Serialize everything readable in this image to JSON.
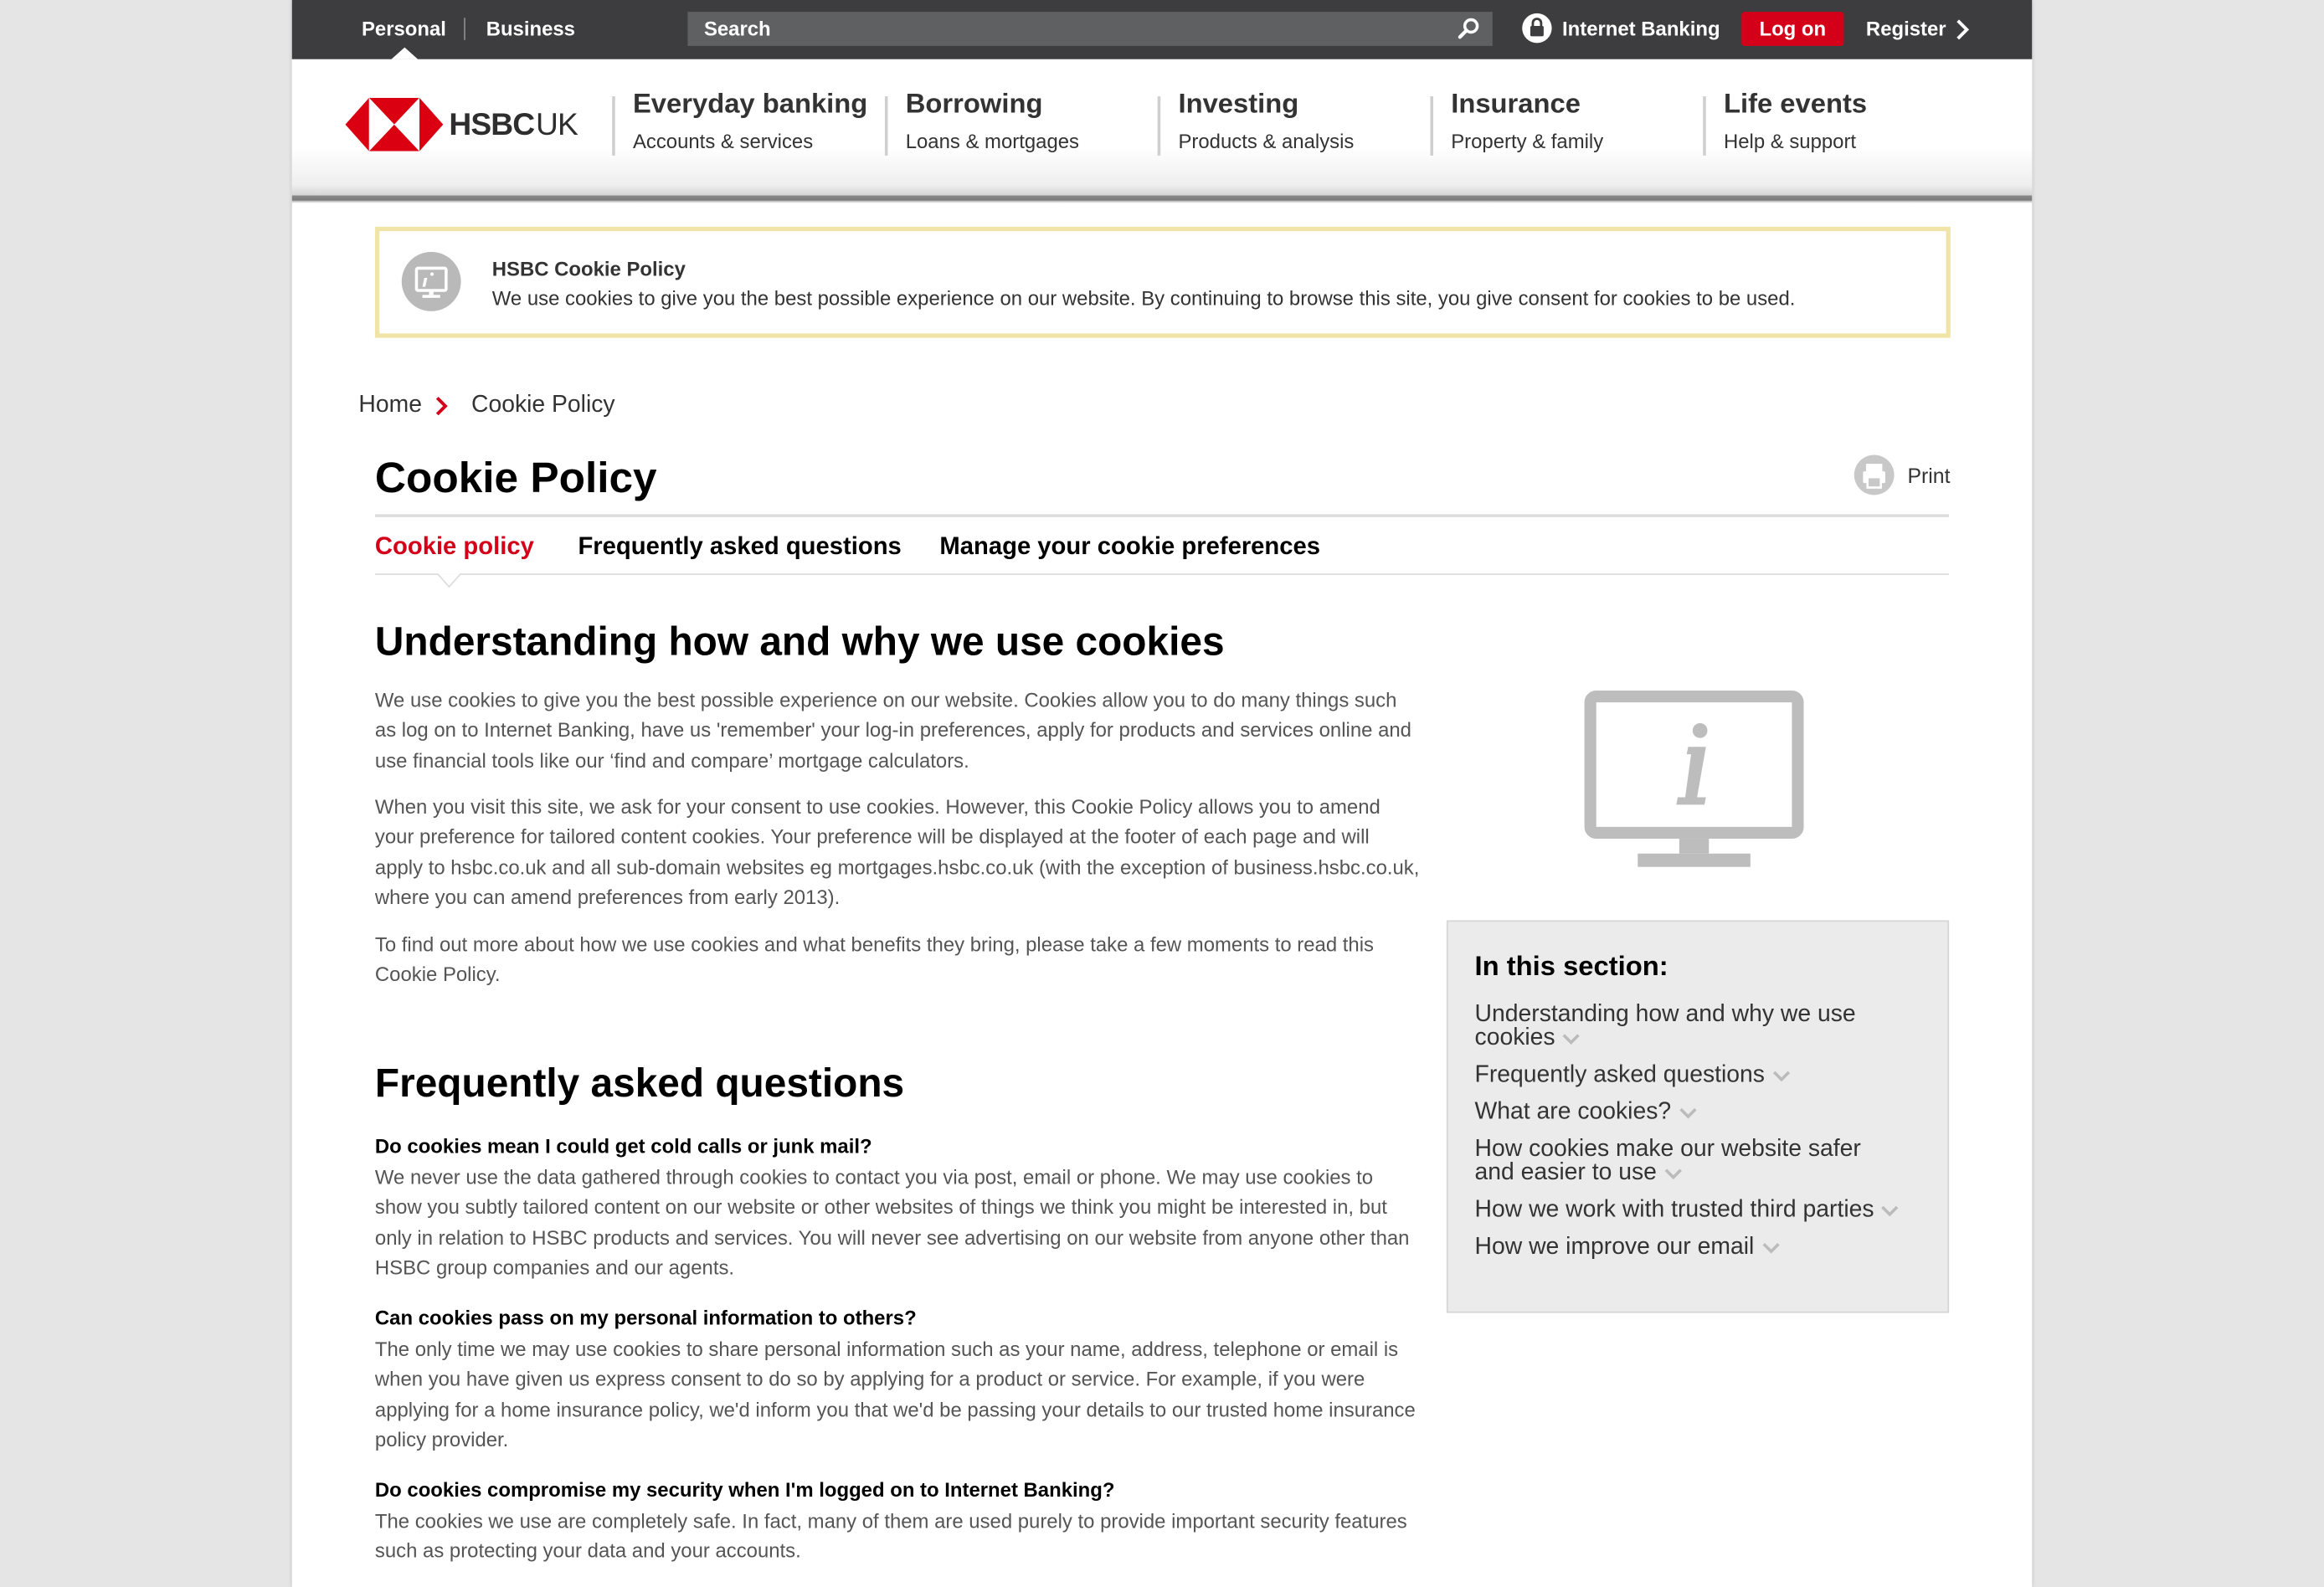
{
  "topbar": {
    "personal": "Personal",
    "business": "Business",
    "search_label": "Search",
    "internet_banking": "Internet Banking",
    "log_on": "Log on",
    "register": "Register"
  },
  "brand": {
    "name": "HSBC",
    "region": "UK",
    "colors": {
      "brand_red": "#db0011",
      "accent_red": "#d40019",
      "topbar": "#3d3d3f",
      "banner_border": "#f0e4a9"
    }
  },
  "nav": [
    {
      "title": "Everyday banking",
      "sub": "Accounts & services"
    },
    {
      "title": "Borrowing",
      "sub": "Loans & mortgages"
    },
    {
      "title": "Investing",
      "sub": "Products & analysis"
    },
    {
      "title": "Insurance",
      "sub": "Property & family"
    },
    {
      "title": "Life events",
      "sub": "Help & support"
    }
  ],
  "cookie_banner": {
    "title": "HSBC Cookie Policy",
    "text": "We use cookies to give you the best possible experience on our website. By continuing to browse this site, you give consent for cookies to be used."
  },
  "breadcrumb": {
    "home": "Home",
    "current": "Cookie Policy"
  },
  "page": {
    "title": "Cookie Policy",
    "print": "Print"
  },
  "tabs": [
    {
      "label": "Cookie policy",
      "active": true
    },
    {
      "label": "Frequently asked questions",
      "active": false
    },
    {
      "label": "Manage your cookie preferences",
      "active": false
    }
  ],
  "section1": {
    "heading": "Understanding how and why we use cookies",
    "paragraphs": [
      "We use cookies to give you the best possible experience on our website. Cookies allow you to do many things such as log on to Internet Banking, have us 'remember' your log-in preferences, apply for products and services online and use financial tools like our ‘find and compare’ mortgage calculators.",
      "When you visit this site, we ask for your consent to use cookies. However, this Cookie Policy allows you to amend your preference for tailored content cookies. Your preference will be displayed at the footer of each page and will apply to hsbc.co.uk and all sub-domain websites eg mortgages.hsbc.co.uk (with the exception of business.hsbc.co.uk, where you can amend preferences from early 2013).",
      "To find out more about how we use cookies and what benefits they bring, please take a few moments to read this Cookie Policy."
    ]
  },
  "faq": {
    "heading": "Frequently asked questions",
    "items": [
      {
        "q": "Do cookies mean I could get cold calls or junk mail?",
        "a": "We never use the data gathered through cookies to contact you via post, email or phone. We may use cookies to show you subtly tailored content on our website or other websites of things we think you might be interested in, but only in relation to HSBC products and services. You will never see advertising on our website from anyone other than HSBC group companies and our agents."
      },
      {
        "q": "Can cookies pass on my personal information to others?",
        "a": "The only time we may use cookies to share personal information such as your name, address, telephone or email is when you have given us express consent to do so by applying for a product or service. For example, if you were applying for a home insurance policy, we'd inform you that we'd be passing your details to our trusted home insurance policy provider."
      },
      {
        "q": "Do cookies compromise my security when I'm logged on to Internet Banking?",
        "a": "The cookies we use are completely safe. In fact, many of them are used purely to provide important security features such as protecting your data and your accounts."
      }
    ]
  },
  "sidebar": {
    "title": "In this section:",
    "items": [
      "Understanding how and why we use cookies",
      "Frequently asked questions",
      "What are cookies?",
      "How cookies make our website safer and easier to use",
      "How we work with trusted third parties",
      "How we improve our email"
    ]
  },
  "icons": {
    "search": "search-icon",
    "lock": "lock-icon",
    "chevron": "chevron-right-icon",
    "info_monitor": "info-monitor-icon",
    "print": "print-icon"
  }
}
